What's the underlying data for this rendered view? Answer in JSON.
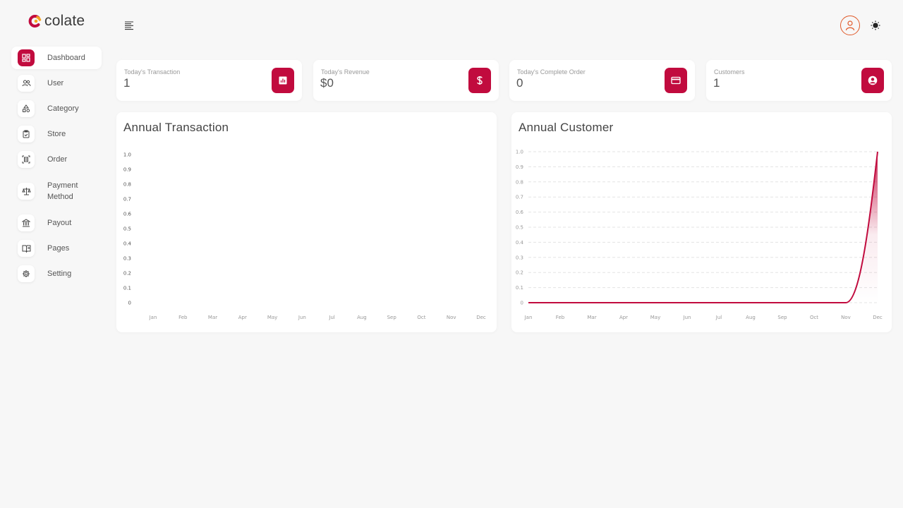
{
  "app": {
    "logo_text": "colate",
    "brand_color": "#c10b3e",
    "accent_color": "#e05a2a"
  },
  "sidebar": {
    "items": [
      {
        "label": "Dashboard",
        "icon": "dashboard-icon",
        "active": true
      },
      {
        "label": "User",
        "icon": "users-icon"
      },
      {
        "label": "Category",
        "icon": "category-icon"
      },
      {
        "label": "Store",
        "icon": "store-icon"
      },
      {
        "label": "Order",
        "icon": "order-icon"
      },
      {
        "label": "Payment Method",
        "label_line1": "Payment",
        "label_line2": "Method",
        "icon": "scale-icon"
      },
      {
        "label": "Payout",
        "icon": "bank-icon"
      },
      {
        "label": "Pages",
        "icon": "book-icon"
      },
      {
        "label": "Setting",
        "icon": "gear-icon"
      }
    ]
  },
  "header": {
    "menu_icon": "hamburger-icon",
    "profile_icon": "user-avatar-icon",
    "theme_icon": "sun-icon"
  },
  "stats": [
    {
      "label": "Today's Transaction",
      "value": "1",
      "icon": "chart-icon"
    },
    {
      "label": "Today's Revenue",
      "value": "$0",
      "icon": "dollar-icon"
    },
    {
      "label": "Today's Complete Order",
      "value": "0",
      "icon": "credit-card-icon"
    },
    {
      "label": "Customers",
      "value": "1",
      "icon": "user-circle-icon"
    }
  ],
  "chart_data": [
    {
      "type": "line",
      "title": "Annual Transaction",
      "categories": [
        "Jan",
        "Feb",
        "Mar",
        "Apr",
        "May",
        "Jun",
        "Jul",
        "Aug",
        "Sep",
        "Oct",
        "Nov",
        "Dec"
      ],
      "y_ticks": [
        "0",
        "0.1",
        "0.2",
        "0.3",
        "0.4",
        "0.5",
        "0.6",
        "0.7",
        "0.8",
        "0.9",
        "1.0"
      ],
      "ylim": [
        0,
        1
      ],
      "series": [],
      "grid": false
    },
    {
      "type": "area",
      "title": "Annual Customer",
      "categories": [
        "Jan",
        "Feb",
        "Mar",
        "Apr",
        "May",
        "Jun",
        "Jul",
        "Aug",
        "Sep",
        "Oct",
        "Nov",
        "Dec"
      ],
      "y_ticks": [
        "0",
        "0.1",
        "0.2",
        "0.3",
        "0.4",
        "0.5",
        "0.6",
        "0.7",
        "0.8",
        "0.9",
        "1.0"
      ],
      "ylim": [
        0,
        1
      ],
      "series": [
        {
          "values": [
            0,
            0,
            0,
            0,
            0,
            0,
            0,
            0,
            0,
            0,
            0,
            1
          ],
          "color": "#c10b3e"
        }
      ],
      "grid": true
    }
  ]
}
